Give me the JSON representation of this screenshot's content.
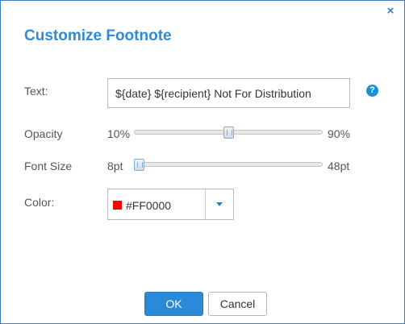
{
  "dialog": {
    "title": "Customize Footnote",
    "close_glyph": "×"
  },
  "text_row": {
    "label": "Text:",
    "value": "${date} ${recipient} Not For Distribution",
    "help_glyph": "?"
  },
  "opacity_row": {
    "label": "Opacity",
    "min_label": "10%",
    "max_label": "90%",
    "value_fraction": 0.5
  },
  "font_size_row": {
    "label": "Font Size",
    "min_label": "8pt",
    "max_label": "48pt",
    "value_fraction": 0.0
  },
  "color_row": {
    "label": "Color:",
    "value": "#FF0000",
    "swatch_color": "#FF0000"
  },
  "buttons": {
    "ok_label": "OK",
    "cancel_label": "Cancel"
  },
  "colors": {
    "accent": "#2A8AD8",
    "title": "#2F8BD8",
    "border": "#3D7BBF"
  }
}
